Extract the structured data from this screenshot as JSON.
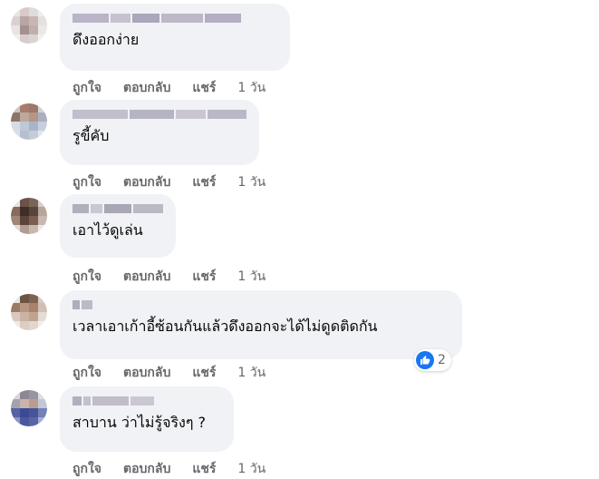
{
  "actions": {
    "like": "ถูกใจ",
    "reply": "ตอบกลับ",
    "share": "แชร์"
  },
  "colors": {
    "bubble": "#f0f2f5",
    "action_text": "#65676b",
    "like_blue": "#1877f2"
  },
  "comments": [
    {
      "text": "ดึงออกง่าย",
      "time": "1 วัน"
    },
    {
      "text": "รูขี้คับ",
      "time": "1 วัน"
    },
    {
      "text": "เอาไว้ดูเล่น",
      "time": "1 วัน"
    },
    {
      "text": "เวลาเอาเก้าอี้ซ้อนกันแล้วดึงออกจะได้ไม่ดูดติดกัน",
      "time": "1 วัน",
      "reactions": {
        "icon": "like-icon",
        "count": "2"
      }
    },
    {
      "text": "สาบาน ว่าไม่รู้จริงๆ ?",
      "time": "1 วัน"
    }
  ]
}
